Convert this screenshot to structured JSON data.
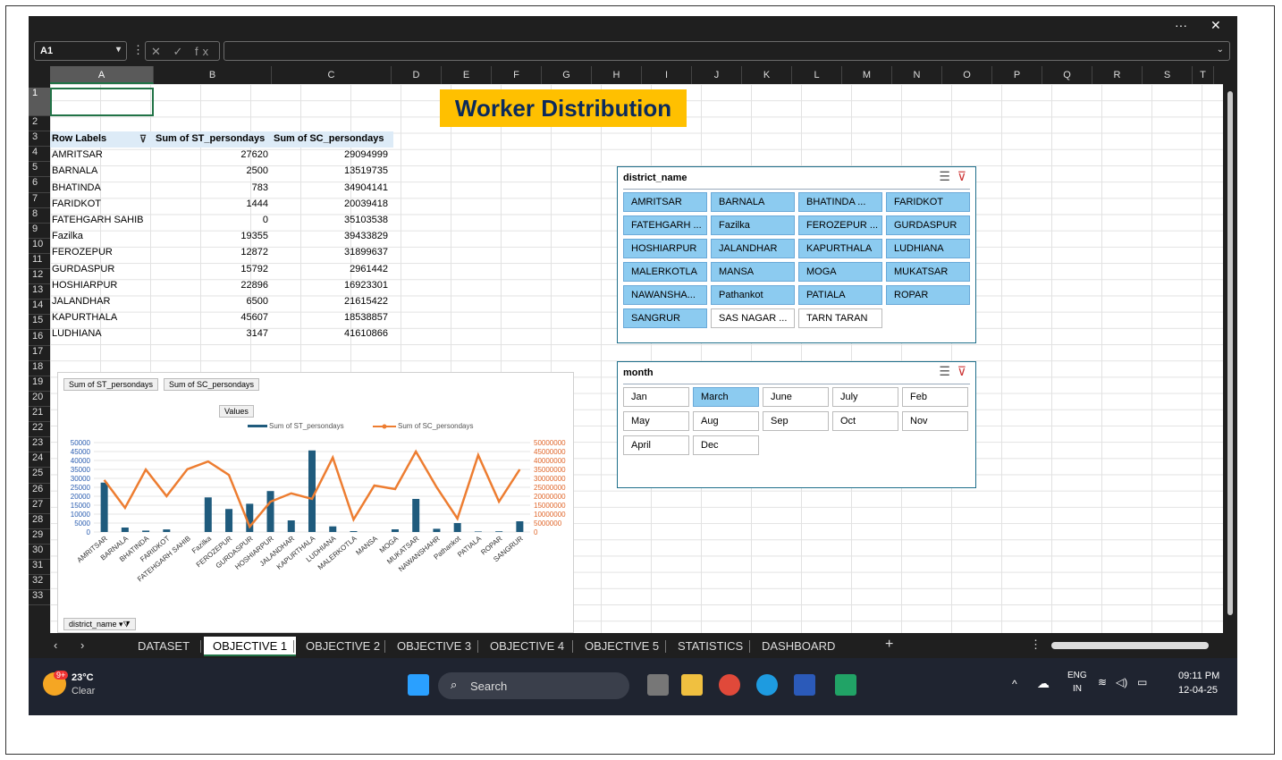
{
  "window": {
    "more_label": "···",
    "close_label": "✕"
  },
  "formula_bar": {
    "cell_ref": "A1",
    "fx_label": "✕ ✓ fx"
  },
  "columns": [
    "A",
    "B",
    "C",
    "D",
    "E",
    "F",
    "G",
    "H",
    "I",
    "J",
    "K",
    "L",
    "M",
    "N",
    "O",
    "P",
    "Q",
    "R",
    "S",
    "T"
  ],
  "rows": [
    "1",
    "2",
    "3",
    "4",
    "5",
    "6",
    "7",
    "8",
    "9",
    "10",
    "11",
    "12",
    "13",
    "14",
    "15",
    "16",
    "17",
    "18",
    "19",
    "20",
    "21",
    "22",
    "23",
    "24",
    "25",
    "26",
    "27",
    "28",
    "29",
    "30",
    "31",
    "32",
    "33"
  ],
  "banner_title": "Worker Distribution",
  "pivot": {
    "headers": [
      "Row Labels",
      "Sum of ST_persondays",
      "Sum of SC_persondays"
    ],
    "rows": [
      [
        "AMRITSAR",
        "27620",
        "29094999"
      ],
      [
        "BARNALA",
        "2500",
        "13519735"
      ],
      [
        "BHATINDA",
        "783",
        "34904141"
      ],
      [
        "FARIDKOT",
        "1444",
        "20039418"
      ],
      [
        "FATEHGARH SAHIB",
        "0",
        "35103538"
      ],
      [
        "Fazilka",
        "19355",
        "39433829"
      ],
      [
        "FEROZEPUR",
        "12872",
        "31899637"
      ],
      [
        "GURDASPUR",
        "15792",
        "2961442"
      ],
      [
        "HOSHIARPUR",
        "22896",
        "16923301"
      ],
      [
        "JALANDHAR",
        "6500",
        "21615422"
      ],
      [
        "KAPURTHALA",
        "45607",
        "18538857"
      ],
      [
        "LUDHIANA",
        "3147",
        "41610866"
      ]
    ]
  },
  "chart_data": {
    "type": "bar",
    "categories": [
      "AMRITSAR",
      "BARNALA",
      "BHATINDA",
      "FARIDKOT",
      "FATEHGARH SAHIB",
      "Fazilka",
      "FEROZEPUR",
      "GURDASPUR",
      "HOSHIARPUR",
      "JALANDHAR",
      "KAPURTHALA",
      "LUDHIANA",
      "MALERKOTLA",
      "MANSA",
      "MOGA",
      "MUKATSAR",
      "NAWANSHAHR",
      "Pathankot",
      "PATIALA",
      "ROPAR",
      "SANGRUR"
    ],
    "series": [
      {
        "name": "Sum of ST_persondays",
        "type": "bar",
        "axis": "left",
        "color": "#1f5b7d",
        "values": [
          27620,
          2500,
          783,
          1444,
          0,
          19355,
          12872,
          15792,
          22896,
          6500,
          45607,
          3147,
          500,
          0,
          1500,
          18500,
          1800,
          5000,
          300,
          400,
          6000
        ]
      },
      {
        "name": "Sum of SC_persondays",
        "type": "line",
        "axis": "right",
        "color": "#ed7d31",
        "values": [
          29094999,
          13519735,
          34904141,
          20039418,
          35103538,
          39433829,
          31899637,
          2961442,
          16923301,
          21615422,
          18538857,
          41610866,
          7000000,
          26000000,
          24000000,
          45000000,
          25000000,
          7500000,
          43000000,
          17000000,
          35000000
        ]
      }
    ],
    "y_left_ticks": [
      "50000",
      "45000",
      "40000",
      "35000",
      "30000",
      "25000",
      "20000",
      "15000",
      "10000",
      "5000",
      "0"
    ],
    "y_right_ticks": [
      "50000000",
      "45000000",
      "40000000",
      "35000000",
      "30000000",
      "25000000",
      "20000000",
      "15000000",
      "10000000",
      "5000000",
      "0"
    ],
    "ylim_left": [
      0,
      50000
    ],
    "ylim_right": [
      0,
      50000000
    ],
    "field_buttons": [
      "Sum of ST_persondays",
      "Sum of SC_persondays"
    ],
    "values_button": "Values",
    "axis_field_button": "district_name",
    "legend_position": "top"
  },
  "slicer_district": {
    "title": "district_name",
    "items": [
      {
        "label": "AMRITSAR",
        "selected": true
      },
      {
        "label": "BARNALA",
        "selected": true
      },
      {
        "label": "BHATINDA    ...",
        "selected": true
      },
      {
        "label": "FARIDKOT",
        "selected": true
      },
      {
        "label": "FATEHGARH ...",
        "selected": true
      },
      {
        "label": "Fazilka",
        "selected": true
      },
      {
        "label": "FEROZEPUR  ...",
        "selected": true
      },
      {
        "label": "GURDASPUR",
        "selected": true
      },
      {
        "label": "HOSHIARPUR",
        "selected": true
      },
      {
        "label": "JALANDHAR",
        "selected": true
      },
      {
        "label": "KAPURTHALA",
        "selected": true
      },
      {
        "label": "LUDHIANA",
        "selected": true
      },
      {
        "label": "MALERKOTLA",
        "selected": true
      },
      {
        "label": "MANSA",
        "selected": true
      },
      {
        "label": "MOGA",
        "selected": true
      },
      {
        "label": "MUKATSAR",
        "selected": true
      },
      {
        "label": "NAWANSHA...",
        "selected": true
      },
      {
        "label": "Pathankot",
        "selected": true
      },
      {
        "label": "PATIALA",
        "selected": true
      },
      {
        "label": "ROPAR",
        "selected": true
      },
      {
        "label": "SANGRUR",
        "selected": true
      },
      {
        "label": "SAS NAGAR ...",
        "selected": false
      },
      {
        "label": "TARN TARAN",
        "selected": false
      }
    ]
  },
  "slicer_month": {
    "title": "month",
    "items": [
      {
        "label": "Jan",
        "selected": false
      },
      {
        "label": "March",
        "selected": true
      },
      {
        "label": "June",
        "selected": false
      },
      {
        "label": "July",
        "selected": false
      },
      {
        "label": "Feb",
        "selected": false
      },
      {
        "label": "May",
        "selected": false
      },
      {
        "label": "Aug",
        "selected": false
      },
      {
        "label": "Sep",
        "selected": false
      },
      {
        "label": "Oct",
        "selected": false
      },
      {
        "label": "Nov",
        "selected": false
      },
      {
        "label": "April",
        "selected": false
      },
      {
        "label": "Dec",
        "selected": false
      }
    ]
  },
  "sheet_tabs": [
    "DATASET",
    "OBJECTIVE 1",
    "OBJECTIVE 2",
    "OBJECTIVE 3",
    "OBJECTIVE 4",
    "OBJECTIVE 5",
    "STATISTICS",
    "DASHBOARD"
  ],
  "active_tab": "OBJECTIVE 1",
  "taskbar": {
    "weather_temp": "23°C",
    "weather_desc": "Clear",
    "weather_badge": "9+",
    "search_placeholder": "Search",
    "lang_primary": "ENG",
    "lang_secondary": "IN",
    "time": "09:11 PM",
    "date": "12-04-25"
  }
}
